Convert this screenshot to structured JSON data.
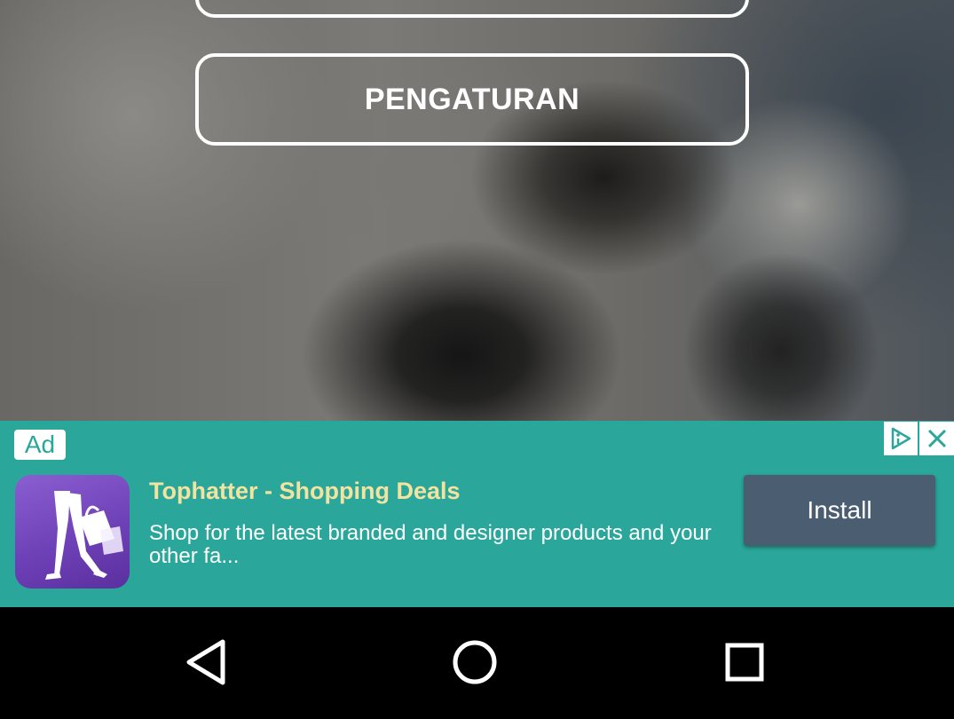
{
  "menu": {
    "top_button_label": "",
    "settings_label": "PENGATURAN"
  },
  "ad": {
    "badge": "Ad",
    "title": "Tophatter - Shopping Deals",
    "description": "Shop for the latest branded and designer products and your other fa...",
    "install_label": "Install",
    "icons": {
      "adchoices": "adchoices-icon",
      "close": "close-icon",
      "app": "tophatter-app-icon"
    },
    "colors": {
      "background": "#2aa79a",
      "title": "#f2e3a0",
      "install_button": "#4b5d70"
    }
  },
  "navbar": {
    "icons": [
      "back-icon",
      "home-icon",
      "recents-icon"
    ]
  }
}
